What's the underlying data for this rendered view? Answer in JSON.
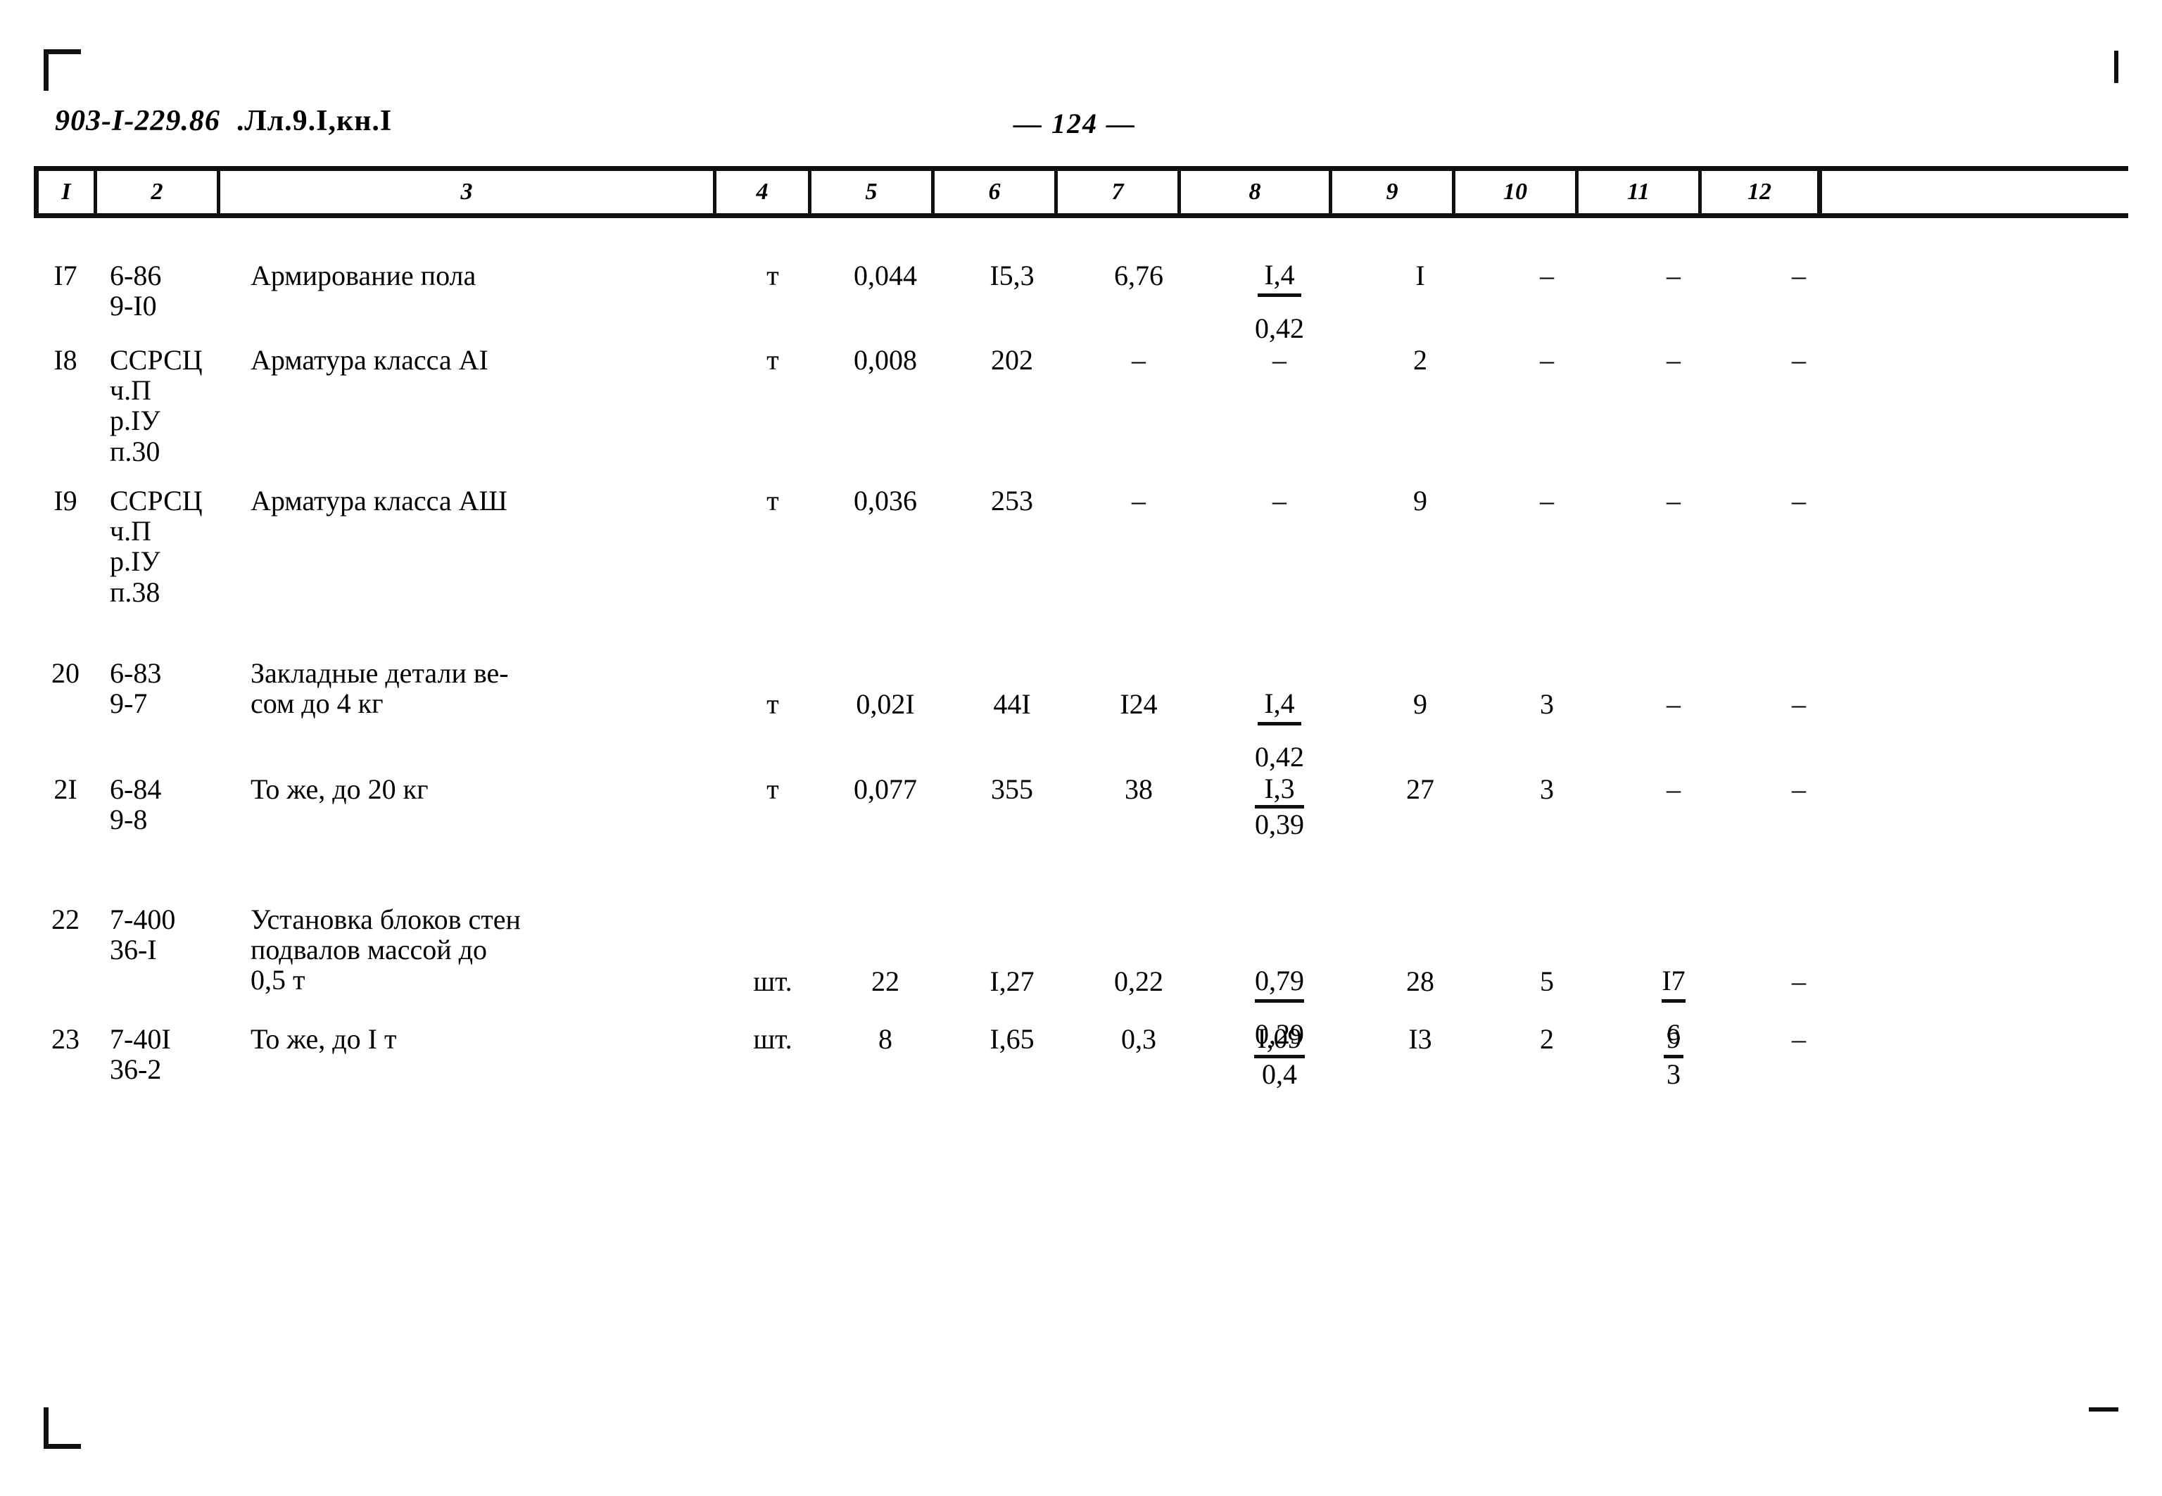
{
  "document": {
    "header_code": "903-I-229.86",
    "header_suffix": ".Лл.9.I,кн.I",
    "page_number": "— 124 —"
  },
  "table": {
    "column_headers": [
      "I",
      "2",
      "3",
      "4",
      "5",
      "6",
      "7",
      "8",
      "9",
      "10",
      "11",
      "12"
    ],
    "rows": [
      {
        "c1": "I7",
        "c2": "6-86\n9-I0",
        "c3": "Армирование пола",
        "c4": "т",
        "c5": "0,044",
        "c6": "I5,3",
        "c7": "6,76",
        "c8_num": "I,4",
        "c8_den": "0,42",
        "c9": "I",
        "c10": "–",
        "c11": "–",
        "c12": "–"
      },
      {
        "c1": "I8",
        "c2": "ССРСЦ\nч.П\nр.IУ\nп.30",
        "c3": "Арматура класса АI",
        "c4": "т",
        "c5": "0,008",
        "c6": "202",
        "c7": "–",
        "c8_num": "–",
        "c8_den": "",
        "c9": "2",
        "c10": "–",
        "c11": "–",
        "c12": "–"
      },
      {
        "c1": "I9",
        "c2": "ССРСЦ\nч.П\nр.IУ\nп.38",
        "c3": "Арматура класса АШ",
        "c4": "т",
        "c5": "0,036",
        "c6": "253",
        "c7": "–",
        "c8_num": "–",
        "c8_den": "",
        "c9": "9",
        "c10": "–",
        "c11": "–",
        "c12": "–"
      },
      {
        "c1": "20",
        "c2": "6-83\n9-7",
        "c3": "Закладные детали ве-\nсом до 4 кг",
        "c4": "т",
        "c5": "0,02I",
        "c6": "44I",
        "c7": "I24",
        "c8_num": "I,4",
        "c8_den": "0,42",
        "c9": "9",
        "c10": "3",
        "c11": "–",
        "c12": "–"
      },
      {
        "c1": "2I",
        "c2": "6-84\n9-8",
        "c3": "То же, до 20 кг",
        "c4": "т",
        "c5": "0,077",
        "c6": "355",
        "c7": "38",
        "c8_num": "I,3",
        "c8_den": "0,39",
        "c9": "27",
        "c10": "3",
        "c11": "–",
        "c12": "–"
      },
      {
        "c1": "22",
        "c2": "7-400\n36-I",
        "c3": "Установка блоков стен\nподвалов массой до\n0,5 т",
        "c4": "шт.",
        "c5": "22",
        "c6": "I,27",
        "c7": "0,22",
        "c8_num": "0,79",
        "c8_den": "0,29",
        "c9": "28",
        "c10": "5",
        "c11_num": "I7",
        "c11_den": "6",
        "c12": "–"
      },
      {
        "c1": "23",
        "c2": "7-40I\n36-2",
        "c3": "То же, до I т",
        "c4": "шт.",
        "c5": "8",
        "c6": "I,65",
        "c7": "0,3",
        "c8_num": "I,09",
        "c8_den": "0,4",
        "c9": "I3",
        "c10": "2",
        "c11_num": "9",
        "c11_den": "3",
        "c12": "–"
      }
    ]
  }
}
